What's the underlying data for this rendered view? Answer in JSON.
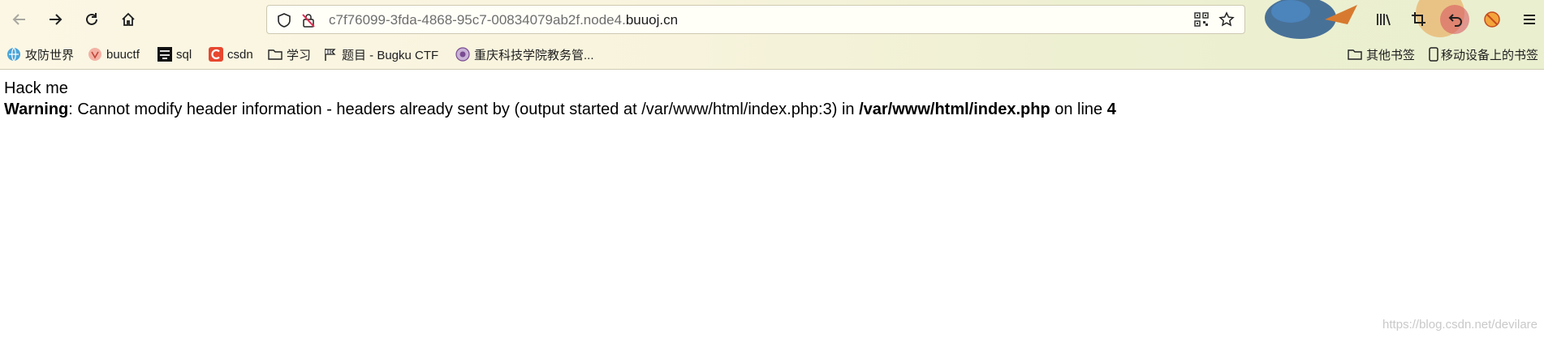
{
  "browser": {
    "url": {
      "subdomain": "c7f76099-3fda-4868-95c7-00834079ab2f.node4.",
      "host": "buuoj.cn"
    },
    "nav": {
      "back": "back-icon",
      "forward": "forward-icon",
      "reload": "reload-icon",
      "home": "home-icon"
    }
  },
  "bookmarks": {
    "items": [
      {
        "label": "攻防世界"
      },
      {
        "label": "buuctf"
      },
      {
        "label": "sql"
      },
      {
        "label": "csdn"
      },
      {
        "label": "学习"
      },
      {
        "label": "题目 - Bugku CTF"
      },
      {
        "label": "重庆科技学院教务管..."
      }
    ],
    "other_label": "其他书签",
    "mobile_label": "移动设备上的书签"
  },
  "page": {
    "line1": "Hack me",
    "warning_label": "Warning",
    "warning_text": ": Cannot modify header information - headers already sent by (output started at /var/www/html/index.php:3) in ",
    "file_path": "/var/www/html/index.php",
    "on_line_text": " on line ",
    "line_number": "4"
  },
  "watermark": "https://blog.csdn.net/devilare",
  "colors": {
    "csdn_red": "#e8472f",
    "theme_bg": "#f7f3dc"
  }
}
